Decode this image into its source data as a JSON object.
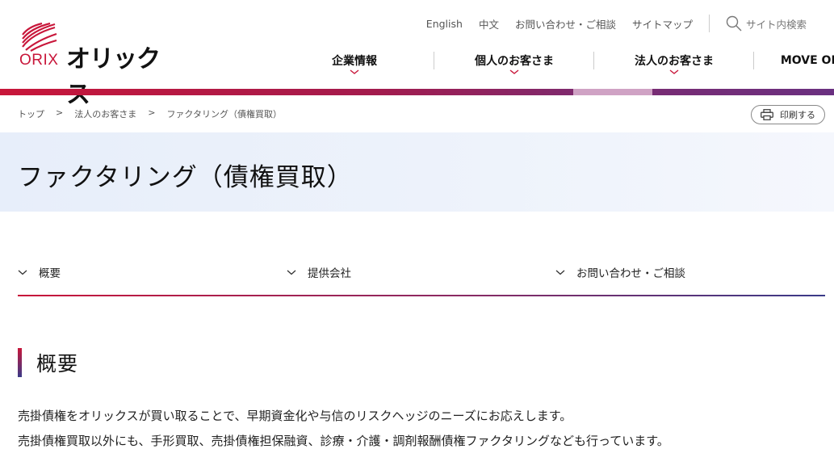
{
  "brand": {
    "logo_en": "ORIX",
    "logo_jp": "オリックス"
  },
  "utility_nav": {
    "items": [
      "English",
      "中文",
      "お問い合わせ・ご相談",
      "サイトマップ"
    ],
    "search_label": "サイト内検索"
  },
  "main_nav": {
    "items": [
      "企業情報",
      "個人のお客さま",
      "法人のお客さま",
      "MOVE ON"
    ]
  },
  "breadcrumb": {
    "items": [
      "トップ",
      ">",
      "法人のお客さま",
      ">",
      "ファクタリング（債権買取）"
    ]
  },
  "print_button": {
    "label": "印刷する"
  },
  "page": {
    "title": "ファクタリング（債権買取）"
  },
  "anchor_nav": {
    "items": [
      "概要",
      "提供会社",
      "お問い合わせ・ご相談"
    ]
  },
  "section": {
    "heading": "概要",
    "paragraphs": [
      "売掛債権をオリックスが買い取ることで、早期資金化や与信のリスクヘッジのニーズにお応えします。",
      "売掛債権買取以外にも、手形買取、売掛債権担保融資、診療・介護・調剤報酬債権ファクタリングなども行っています。"
    ]
  },
  "colors": {
    "brand_red": "#c8163a",
    "brand_purple": "#6a3080",
    "active_tab": "#cfa2c4",
    "title_band": "#e7eefa"
  }
}
